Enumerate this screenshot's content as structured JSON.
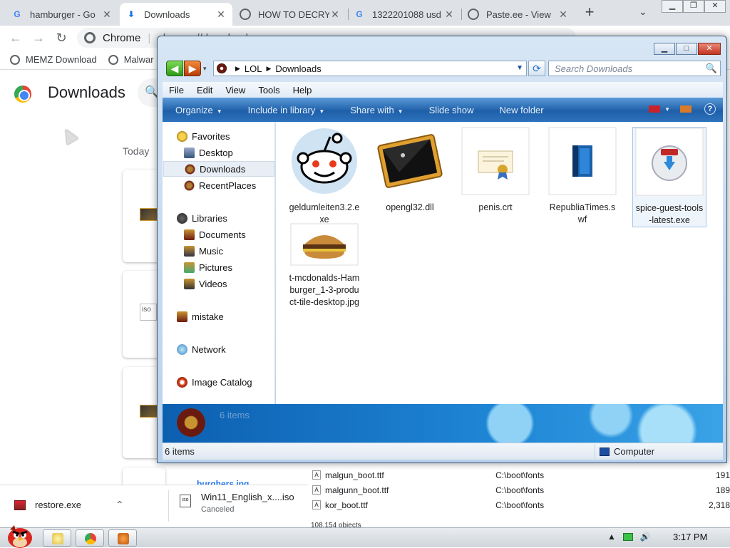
{
  "chrome": {
    "tabs": [
      {
        "title": "hamburger - Go",
        "icon": "google-icon"
      },
      {
        "title": "Downloads",
        "icon": "download-icon"
      },
      {
        "title": "HOW TO DECRY",
        "icon": "globe-icon"
      },
      {
        "title": "1322201088 usd",
        "icon": "google-icon"
      },
      {
        "title": "Paste.ee - View",
        "icon": "globe-icon"
      }
    ],
    "new_tab": "+",
    "omnibox": {
      "site": "Chrome",
      "url": "chrome://downloads"
    },
    "bookmarks": [
      "MEMZ Download",
      "Malwar"
    ],
    "downloads_page": {
      "title": "Downloads",
      "today_label": "Today",
      "partial_filename": "burghers.jpg"
    },
    "download_shelf": [
      {
        "name": "restore.exe",
        "status": ""
      },
      {
        "name": "Win11_English_x....iso",
        "status": "Canceled"
      }
    ]
  },
  "background_file_list": {
    "rows": [
      {
        "name": "malgun_boot.ttf",
        "path": "C:\\boot\\fonts",
        "size": "191"
      },
      {
        "name": "malgunn_boot.ttf",
        "path": "C:\\boot\\fonts",
        "size": "189"
      },
      {
        "name": "kor_boot.ttf",
        "path": "C:\\boot\\fonts",
        "size": "2,318"
      }
    ],
    "object_count": "108,154 objects"
  },
  "explorer": {
    "address": {
      "segments": [
        "LOL",
        "Downloads"
      ]
    },
    "search_placeholder": "Search Downloads",
    "menubar": [
      "File",
      "Edit",
      "View",
      "Tools",
      "Help"
    ],
    "commands": [
      {
        "label": "Organize",
        "dropdown": true
      },
      {
        "label": "Include in library",
        "dropdown": true
      },
      {
        "label": "Share with",
        "dropdown": true
      },
      {
        "label": "Slide show",
        "dropdown": false
      },
      {
        "label": "New folder",
        "dropdown": false
      }
    ],
    "nav": {
      "favorites": "Favorites",
      "favorites_items": [
        "Desktop",
        "Downloads",
        "RecentPlaces"
      ],
      "libraries": "Libraries",
      "libraries_items": [
        "Documents",
        "Music",
        "Pictures",
        "Videos"
      ],
      "user": "mistake",
      "network": "Network",
      "image_catalog": "Image Catalog"
    },
    "files": [
      {
        "name": "geldumleiten3.2.exe",
        "icon": "reddit-alien-icon"
      },
      {
        "name": "opengl32.dll",
        "icon": "dll-file-icon"
      },
      {
        "name": "penis.crt",
        "icon": "certificate-icon"
      },
      {
        "name": "RepubliaTimes.swf",
        "icon": "flash-file-icon"
      },
      {
        "name": "spice-guest-tools-latest.exe",
        "icon": "nsis-installer-icon"
      },
      {
        "name": "t-mcdonalds-Hamburger_1-3-product-tile-desktop.jpg",
        "icon": "hamburger-image-icon"
      }
    ],
    "details_count": "6 items",
    "status_count": "6 items",
    "status_zone": "Computer"
  },
  "taskbar": {
    "clock": "3:17 PM"
  },
  "colors": {
    "explorer_cmdbar": "#1e5fa8",
    "explorer_frame": "#b9d1ea",
    "chrome_tabstrip": "#dee1e6"
  }
}
